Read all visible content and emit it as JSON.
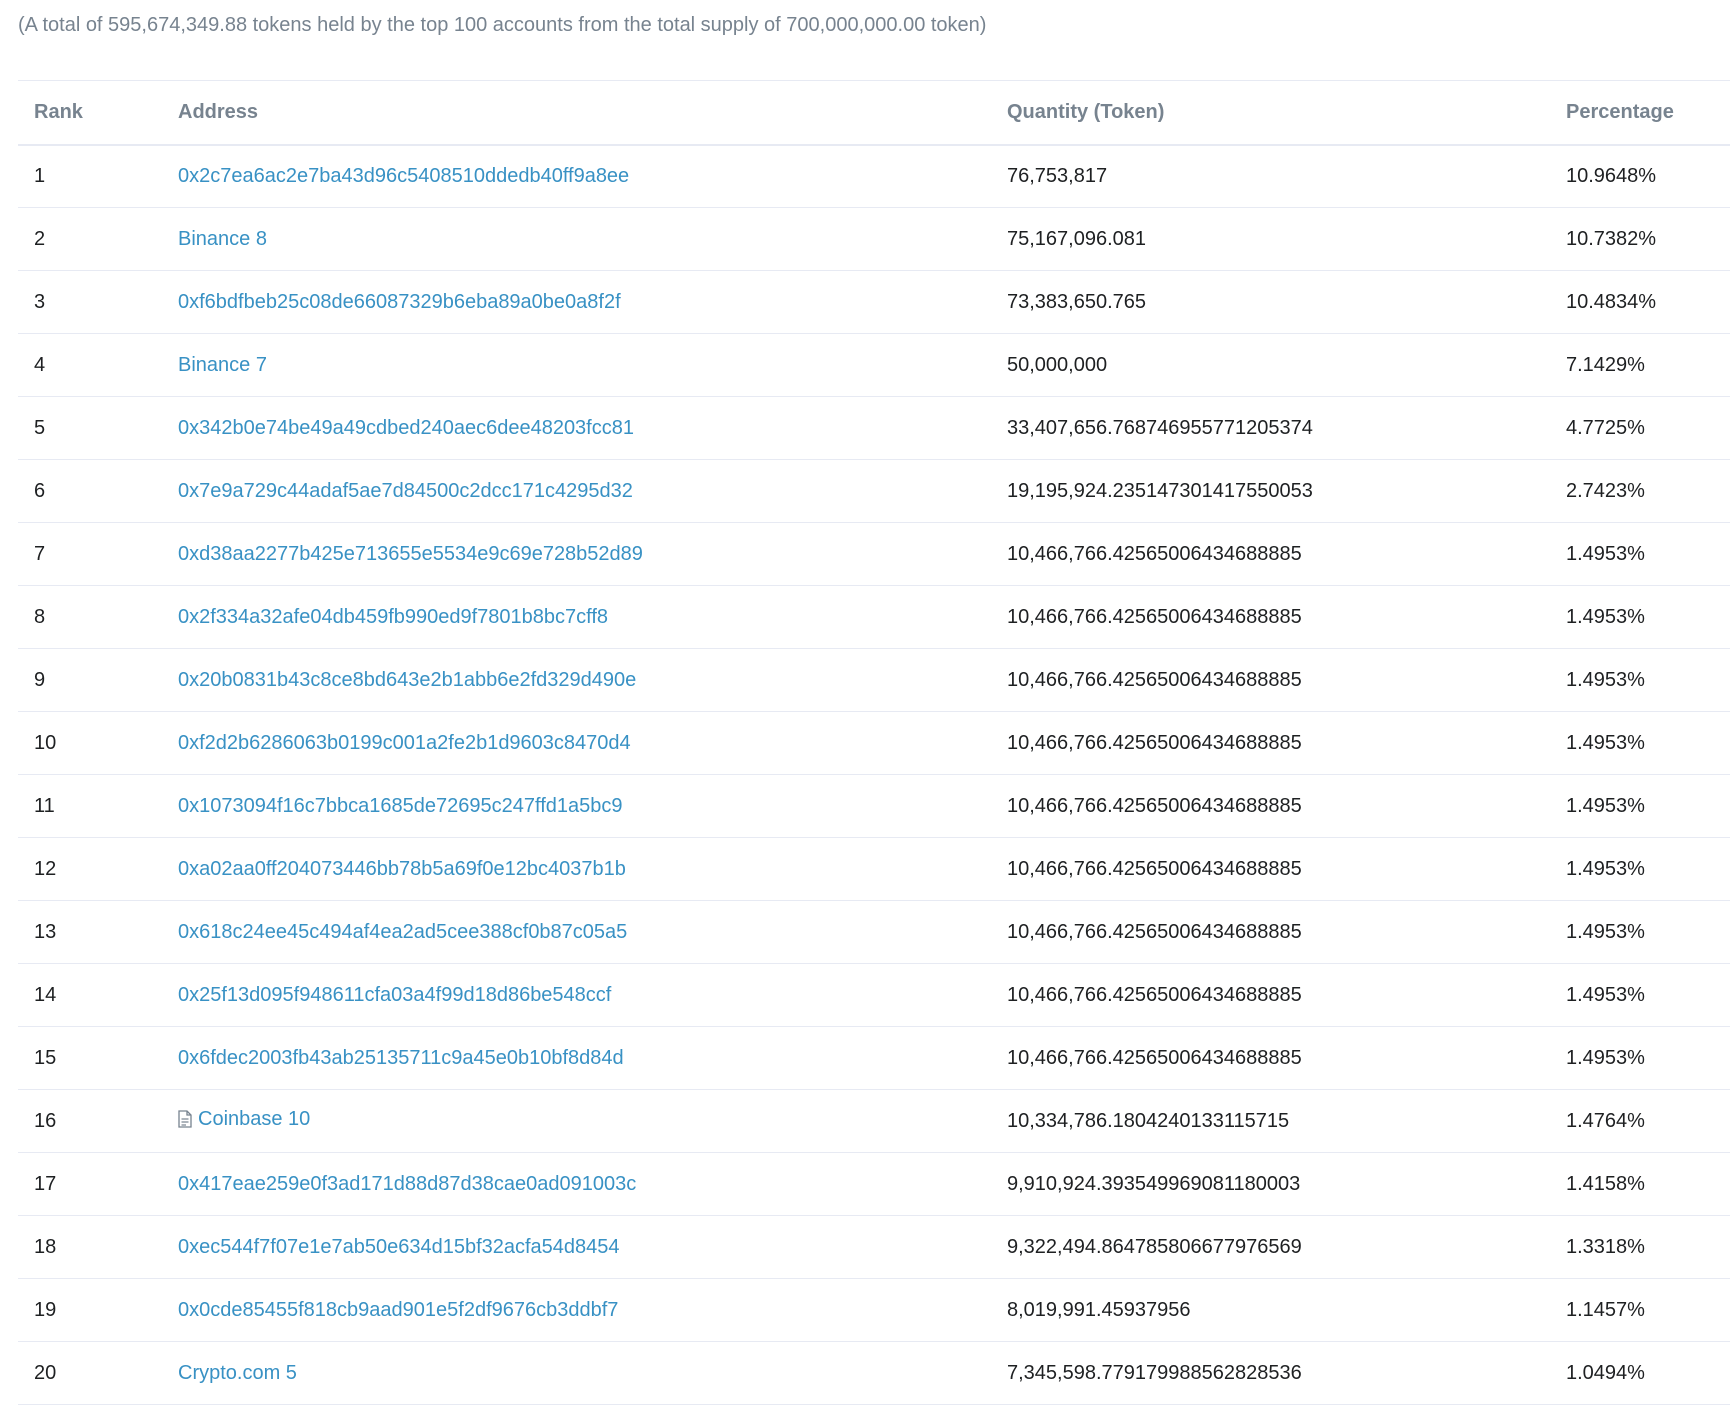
{
  "summary": "(A total of 595,674,349.88 tokens held by the top 100 accounts from the total supply of 700,000,000.00 token)",
  "table": {
    "headers": {
      "rank": "Rank",
      "address": "Address",
      "quantity": "Quantity (Token)",
      "percentage": "Percentage"
    },
    "rows": [
      {
        "rank": "1",
        "address": "0x2c7ea6ac2e7ba43d96c5408510ddedb40ff9a8ee",
        "quantity": "76,753,817",
        "percentage": "10.9648%",
        "icon": ""
      },
      {
        "rank": "2",
        "address": "Binance 8",
        "quantity": "75,167,096.081",
        "percentage": "10.7382%",
        "icon": ""
      },
      {
        "rank": "3",
        "address": "0xf6bdfbeb25c08de66087329b6eba89a0be0a8f2f",
        "quantity": "73,383,650.765",
        "percentage": "10.4834%",
        "icon": ""
      },
      {
        "rank": "4",
        "address": "Binance 7",
        "quantity": "50,000,000",
        "percentage": "7.1429%",
        "icon": ""
      },
      {
        "rank": "5",
        "address": "0x342b0e74be49a49cdbed240aec6dee48203fcc81",
        "quantity": "33,407,656.768746955771205374",
        "percentage": "4.7725%",
        "icon": ""
      },
      {
        "rank": "6",
        "address": "0x7e9a729c44adaf5ae7d84500c2dcc171c4295d32",
        "quantity": "19,195,924.235147301417550053",
        "percentage": "2.7423%",
        "icon": ""
      },
      {
        "rank": "7",
        "address": "0xd38aa2277b425e713655e5534e9c69e728b52d89",
        "quantity": "10,466,766.42565006434688885",
        "percentage": "1.4953%",
        "icon": ""
      },
      {
        "rank": "8",
        "address": "0x2f334a32afe04db459fb990ed9f7801b8bc7cff8",
        "quantity": "10,466,766.42565006434688885",
        "percentage": "1.4953%",
        "icon": ""
      },
      {
        "rank": "9",
        "address": "0x20b0831b43c8ce8bd643e2b1abb6e2fd329d490e",
        "quantity": "10,466,766.42565006434688885",
        "percentage": "1.4953%",
        "icon": ""
      },
      {
        "rank": "10",
        "address": "0xf2d2b6286063b0199c001a2fe2b1d9603c8470d4",
        "quantity": "10,466,766.42565006434688885",
        "percentage": "1.4953%",
        "icon": ""
      },
      {
        "rank": "11",
        "address": "0x1073094f16c7bbca1685de72695c247ffd1a5bc9",
        "quantity": "10,466,766.42565006434688885",
        "percentage": "1.4953%",
        "icon": ""
      },
      {
        "rank": "12",
        "address": "0xa02aa0ff204073446bb78b5a69f0e12bc4037b1b",
        "quantity": "10,466,766.42565006434688885",
        "percentage": "1.4953%",
        "icon": ""
      },
      {
        "rank": "13",
        "address": "0x618c24ee45c494af4ea2ad5cee388cf0b87c05a5",
        "quantity": "10,466,766.42565006434688885",
        "percentage": "1.4953%",
        "icon": ""
      },
      {
        "rank": "14",
        "address": "0x25f13d095f948611cfa03a4f99d18d86be548ccf",
        "quantity": "10,466,766.42565006434688885",
        "percentage": "1.4953%",
        "icon": ""
      },
      {
        "rank": "15",
        "address": "0x6fdec2003fb43ab25135711c9a45e0b10bf8d84d",
        "quantity": "10,466,766.42565006434688885",
        "percentage": "1.4953%",
        "icon": ""
      },
      {
        "rank": "16",
        "address": "Coinbase 10",
        "quantity": "10,334,786.1804240133115715",
        "percentage": "1.4764%",
        "icon": "contract-document-icon"
      },
      {
        "rank": "17",
        "address": "0x417eae259e0f3ad171d88d87d38cae0ad091003c",
        "quantity": "9,910,924.393549969081180003",
        "percentage": "1.4158%",
        "icon": ""
      },
      {
        "rank": "18",
        "address": "0xec544f7f07e1e7ab50e634d15bf32acfa54d8454",
        "quantity": "9,322,494.864785806677976569",
        "percentage": "1.3318%",
        "icon": ""
      },
      {
        "rank": "19",
        "address": "0x0cde85455f818cb9aad901e5f2df9676cb3ddbf7",
        "quantity": "8,019,991.45937956",
        "percentage": "1.1457%",
        "icon": ""
      },
      {
        "rank": "20",
        "address": "Crypto.com 5",
        "quantity": "7,345,598.779179988562828536",
        "percentage": "1.0494%",
        "icon": ""
      }
    ]
  },
  "colors": {
    "link": "#3891c4",
    "header_text": "#77838f",
    "border": "#e7eaf3"
  }
}
